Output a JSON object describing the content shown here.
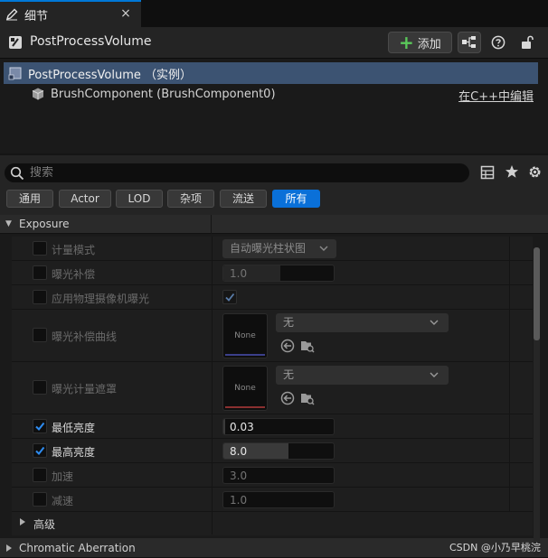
{
  "tab": {
    "label": "细节",
    "close": "×"
  },
  "header": {
    "title": "PostProcessVolume",
    "add_label": "添加"
  },
  "tree": {
    "root_label": "PostProcessVolume （实例）",
    "child_label": "BrushComponent (BrushComponent0)",
    "edit_link": "在C++中编辑"
  },
  "search": {
    "placeholder": "搜索"
  },
  "filters": [
    "通用",
    "Actor",
    "LOD",
    "杂项",
    "流送",
    "所有"
  ],
  "active_filter": "所有",
  "details": {
    "category": "Exposure",
    "properties": [
      {
        "name": "计量模式",
        "checked": false,
        "enabled": false,
        "value": "自动曝光柱状图"
      },
      {
        "name": "曝光补偿",
        "checked": false,
        "enabled": false,
        "value": "1.0"
      },
      {
        "name": "应用物理摄像机曝光",
        "checked": false,
        "enabled": false,
        "value_checked": true
      },
      {
        "name": "曝光补偿曲线",
        "checked": false,
        "enabled": false,
        "thumb": "None",
        "asset": "无"
      },
      {
        "name": "曝光计量遮罩",
        "checked": false,
        "enabled": false,
        "thumb": "None",
        "asset": "无"
      },
      {
        "name": "最低亮度",
        "checked": true,
        "enabled": true,
        "value": "0.03"
      },
      {
        "name": "最高亮度",
        "checked": true,
        "enabled": true,
        "value": "8.0"
      },
      {
        "name": "加速",
        "checked": false,
        "enabled": false,
        "value": "3.0"
      },
      {
        "name": "减速",
        "checked": false,
        "enabled": false,
        "value": "1.0"
      }
    ],
    "advanced_label": "高级",
    "next_category": "Chromatic Aberration"
  },
  "watermark": "CSDN @小乃早桃浣",
  "colors": {
    "accent": "#0a70d8",
    "selection": "#3c5372",
    "add_green": "#5ac85a"
  }
}
